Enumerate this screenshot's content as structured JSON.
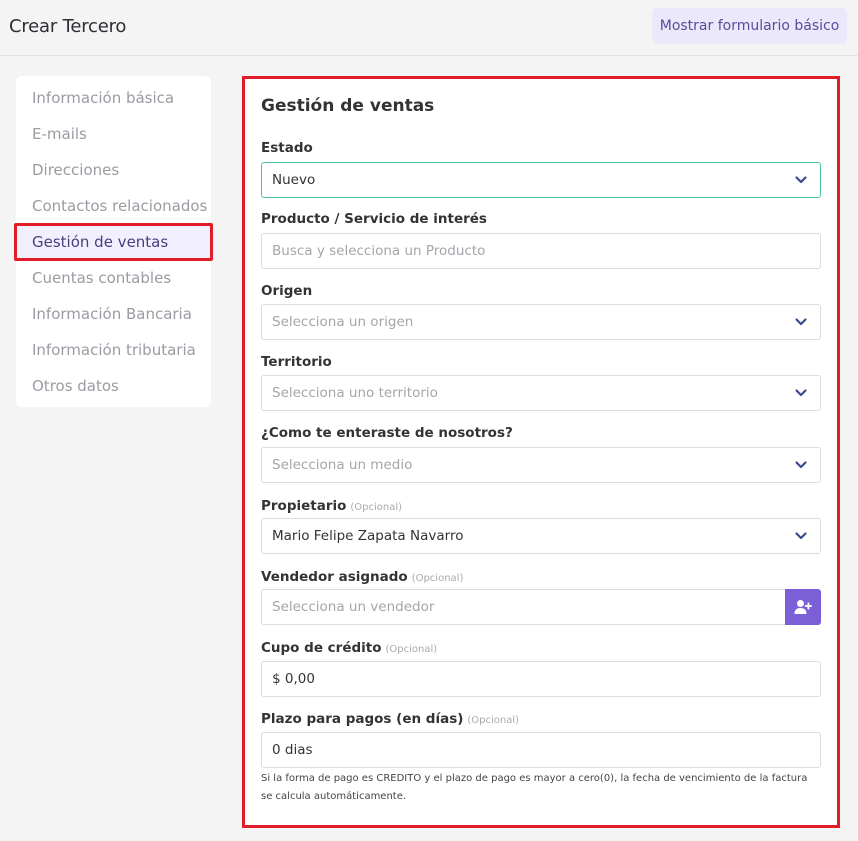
{
  "header": {
    "title": "Crear Tercero",
    "basic_form_button": "Mostrar formulario básico"
  },
  "sidebar": {
    "items": [
      {
        "label": "Información básica"
      },
      {
        "label": "E-mails"
      },
      {
        "label": "Direcciones"
      },
      {
        "label": "Contactos relacionados"
      },
      {
        "label": "Gestión de ventas",
        "active": true
      },
      {
        "label": "Cuentas contables"
      },
      {
        "label": "Información Bancaria"
      },
      {
        "label": "Información tributaria"
      },
      {
        "label": "Otros datos"
      }
    ]
  },
  "form": {
    "title": "Gestión de ventas",
    "optional_tag": "(Opcional)",
    "estado": {
      "label": "Estado",
      "value": "Nuevo"
    },
    "producto": {
      "label": "Producto / Servicio de interés",
      "placeholder": "Busca y selecciona un Producto"
    },
    "origen": {
      "label": "Origen",
      "placeholder": "Selecciona un origen"
    },
    "territorio": {
      "label": "Territorio",
      "placeholder": "Selecciona uno territorio"
    },
    "medio": {
      "label": "¿Como te enteraste de nosotros?",
      "placeholder": "Selecciona un medio"
    },
    "propietario": {
      "label": "Propietario",
      "value": "Mario Felipe Zapata Navarro"
    },
    "vendedor": {
      "label": "Vendedor asignado",
      "placeholder": "Selecciona un vendedor"
    },
    "cupo": {
      "label": "Cupo de crédito",
      "value": "$ 0,00"
    },
    "plazo": {
      "label": "Plazo para pagos (en días)",
      "value": "0 dias"
    },
    "help_text": "Si la forma de pago es CREDITO y el plazo de pago es mayor a cero(0), la fecha de vencimiento de la factura se calcula automáticamente."
  },
  "icons": {
    "chevron": "chevron-down-icon",
    "add_user": "user-plus-icon"
  },
  "colors": {
    "accent": "#7b5fd6",
    "highlight_border": "#e11d2a",
    "focus_border": "#4cc49b",
    "active_bg": "#f2efff"
  }
}
